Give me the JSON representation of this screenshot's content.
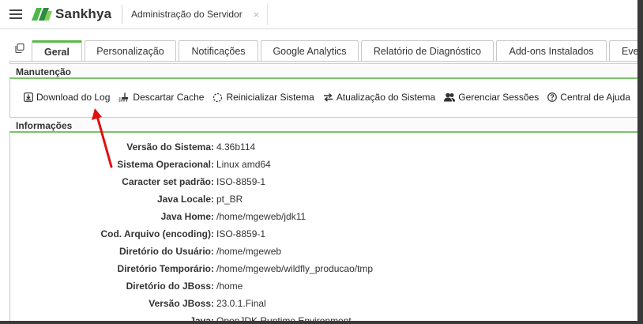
{
  "header": {
    "brand": "Sankhya",
    "document_tab": "Administração do Servidor",
    "document_tab_close": "×"
  },
  "tabs": [
    {
      "label": "Geral",
      "active": true
    },
    {
      "label": "Personalização"
    },
    {
      "label": "Notificações"
    },
    {
      "label": "Google Analytics"
    },
    {
      "label": "Relatório de Diagnóstico"
    },
    {
      "label": "Add-ons Instalados"
    },
    {
      "label": "Even"
    }
  ],
  "maintenance": {
    "title": "Manutenção",
    "actions": [
      {
        "label": "Download do Log",
        "icon": "download-icon"
      },
      {
        "label": "Descartar Cache",
        "icon": "clear-cache-icon"
      },
      {
        "label": "Reinicializar Sistema",
        "icon": "restart-icon"
      },
      {
        "label": "Atualização do Sistema",
        "icon": "update-icon"
      },
      {
        "label": "Gerenciar Sessões",
        "icon": "users-icon"
      },
      {
        "label": "Central de Ajuda",
        "icon": "help-icon"
      }
    ]
  },
  "info": {
    "title": "Informações",
    "rows": [
      {
        "label": "Versão do Sistema:",
        "value": "4.36b114"
      },
      {
        "label": "Sistema Operacional:",
        "value": "Linux amd64"
      },
      {
        "label": "Caracter set padrão:",
        "value": "ISO-8859-1"
      },
      {
        "label": "Java Locale:",
        "value": "pt_BR"
      },
      {
        "label": "Java Home:",
        "value": "/home/mgeweb/jdk11"
      },
      {
        "label": "Cod. Arquivo (encoding):",
        "value": "ISO-8859-1"
      },
      {
        "label": "Diretório do Usuário:",
        "value": "/home/mgeweb"
      },
      {
        "label": "Diretório Temporário:",
        "value": "/home/mgeweb/wildfly_producao/tmp"
      },
      {
        "label": "Diretório do JBoss:",
        "value": "/home"
      },
      {
        "label": "Versão JBoss:",
        "value": "23.0.1.Final"
      },
      {
        "label": "Java:",
        "value": "OpenJDK Runtime Environment"
      }
    ]
  },
  "colors": {
    "accent_green": "#5bb947",
    "annotation_arrow": "#e01010"
  }
}
